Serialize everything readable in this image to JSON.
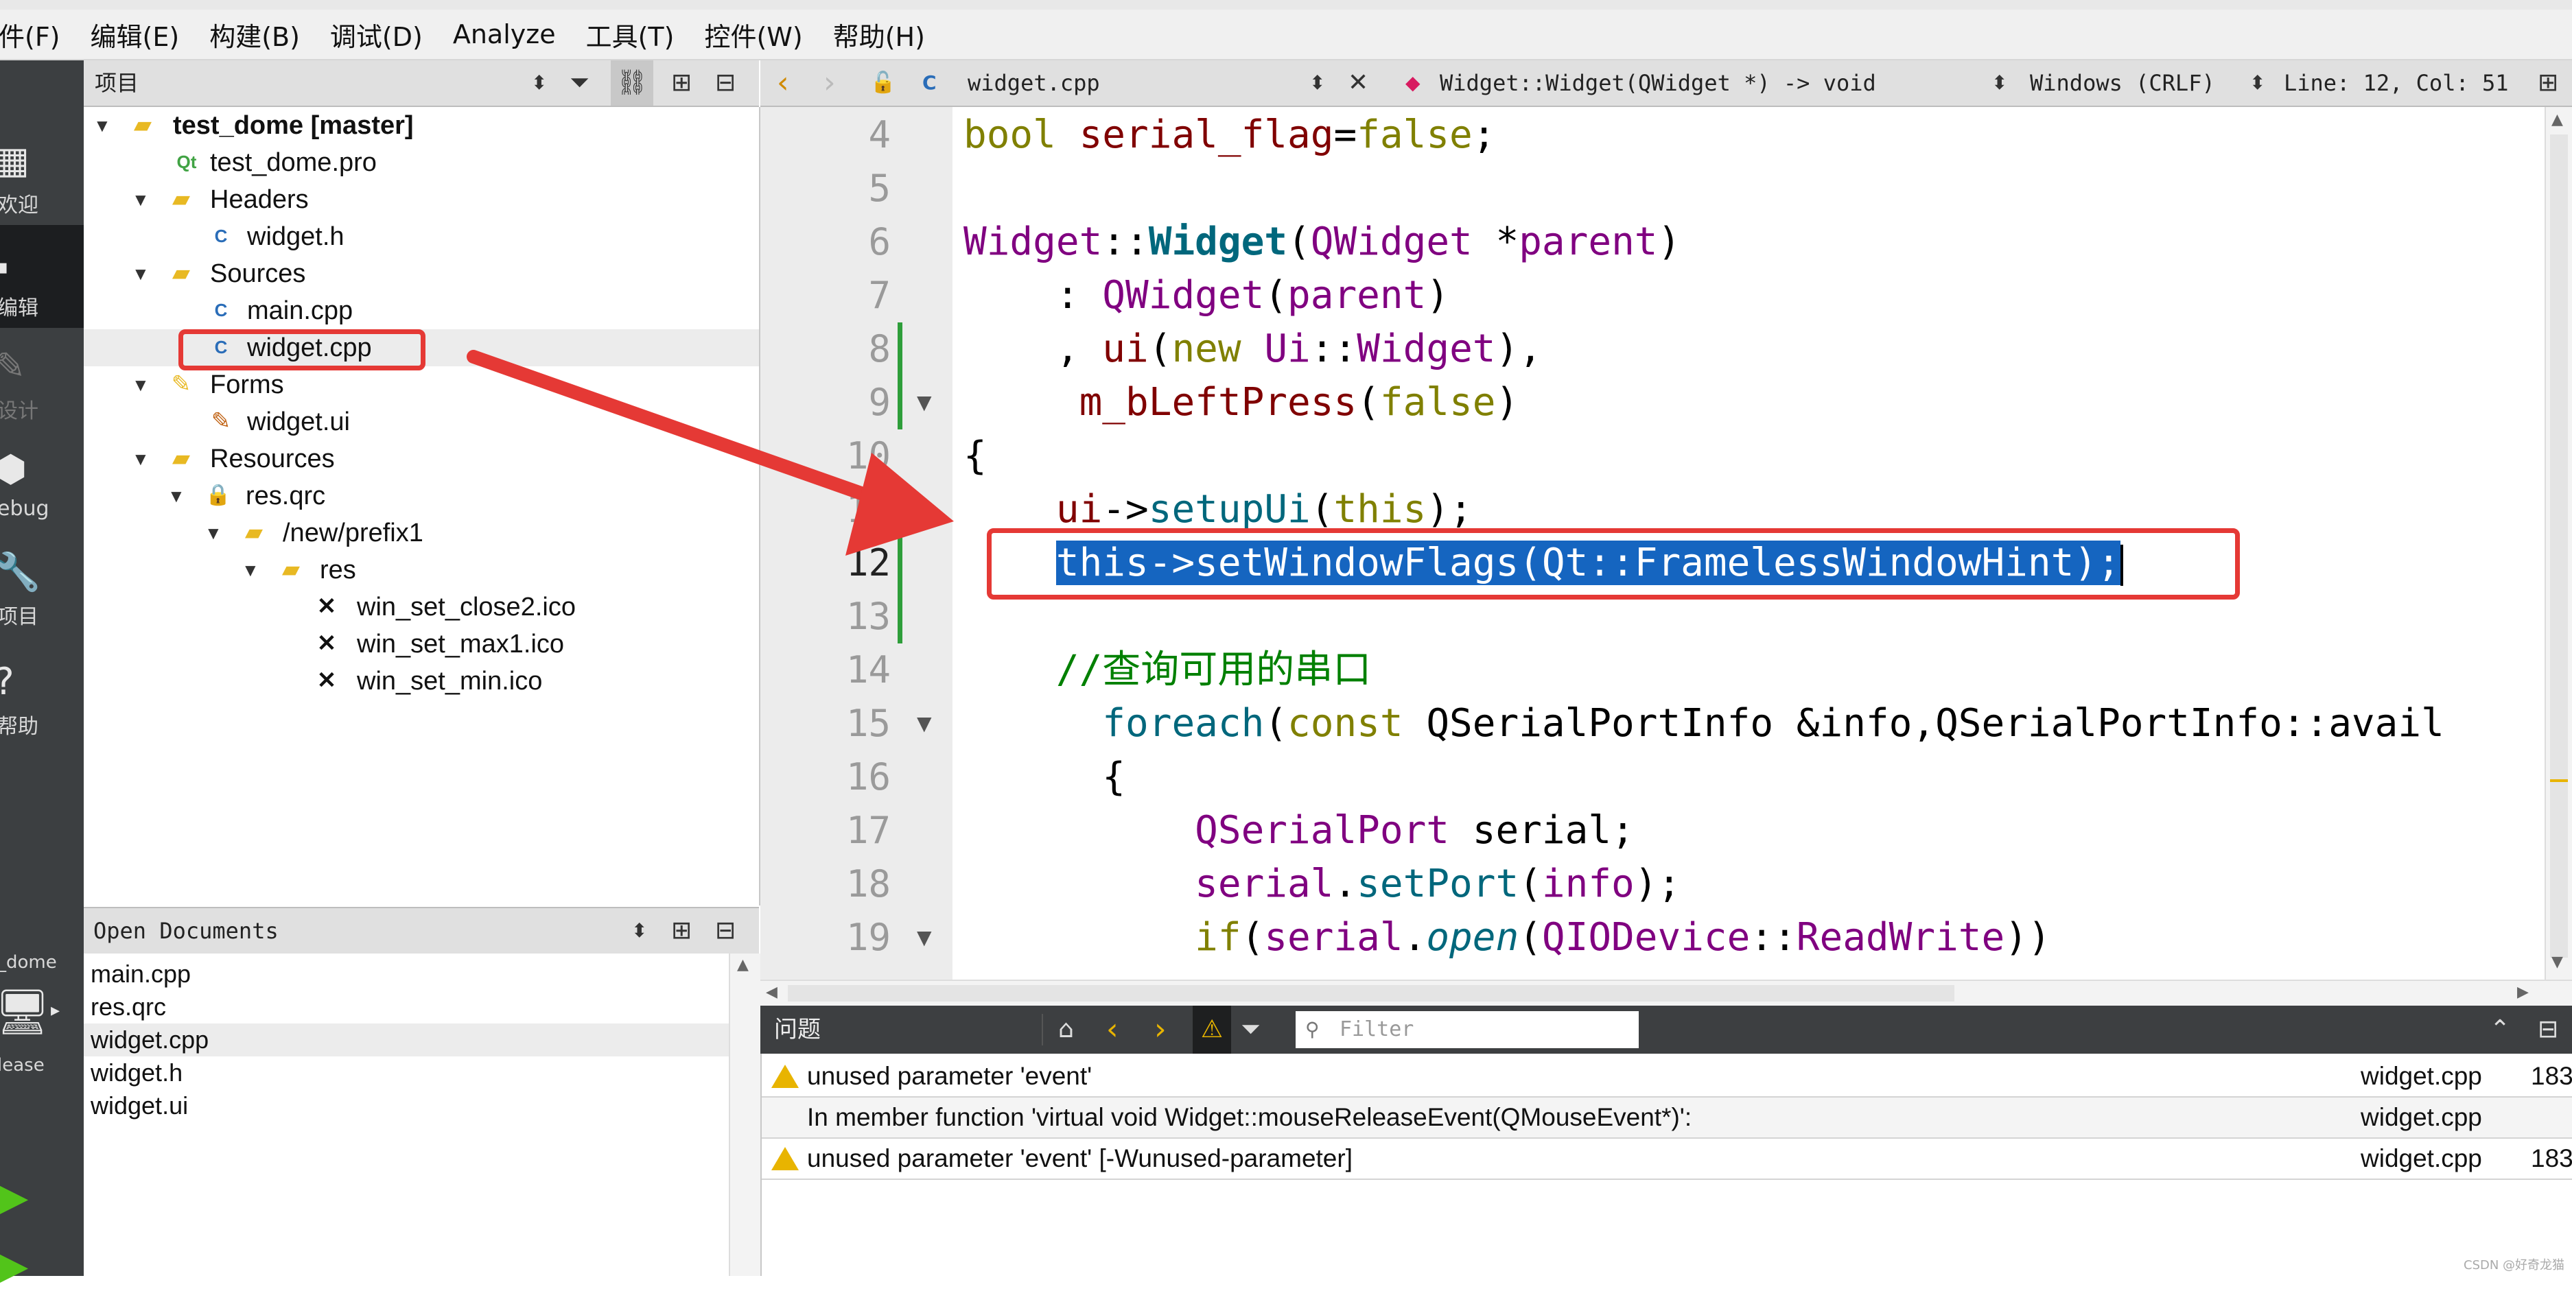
{
  "menu": [
    "件(F)",
    "编辑(E)",
    "构建(B)",
    "调试(D)",
    "Analyze",
    "工具(T)",
    "控件(W)",
    "帮助(H)"
  ],
  "modebar": {
    "welcome": "欢迎",
    "edit": "编辑",
    "design": "设计",
    "debug": "ebug",
    "projects": "项目",
    "help": "帮助",
    "kit": "_dome",
    "build": "lease"
  },
  "project_panel": {
    "title": "项目",
    "tree": [
      {
        "label": "test_dome [master]"
      },
      {
        "label": "test_dome.pro"
      },
      {
        "label": "Headers"
      },
      {
        "label": "widget.h"
      },
      {
        "label": "Sources"
      },
      {
        "label": "main.cpp"
      },
      {
        "label": "widget.cpp"
      },
      {
        "label": "Forms"
      },
      {
        "label": "widget.ui"
      },
      {
        "label": "Resources"
      },
      {
        "label": "res.qrc"
      },
      {
        "label": "/new/prefix1"
      },
      {
        "label": "res"
      },
      {
        "label": "win_set_close2.ico"
      },
      {
        "label": "win_set_max1.ico"
      },
      {
        "label": "win_set_min.ico"
      }
    ]
  },
  "open_documents": {
    "title": "Open Documents",
    "items": [
      "main.cpp",
      "res.qrc",
      "widget.cpp",
      "widget.h",
      "widget.ui"
    ]
  },
  "editor_toolbar": {
    "file": "widget.cpp",
    "symbol": "Widget::Widget(QWidget *) -> void",
    "line_ending": "Windows (CRLF)",
    "position": "Line: 12, Col: 51"
  },
  "line_numbers": [
    "4",
    "5",
    "6",
    "7",
    "8",
    "9",
    "10",
    "11",
    "12",
    "13",
    "14",
    "15",
    "16",
    "17",
    "18",
    "19"
  ],
  "code": {
    "l4a": "bool",
    "l4b": " ",
    "l4c": "serial_flag",
    "l4d": "=",
    "l4e": "false",
    "l4f": ";",
    "l6a": "Widget",
    "l6b": "::",
    "l6c": "Widget",
    "l6d": "(",
    "l6e": "QWidget",
    "l6f": " *",
    "l6g": "parent",
    "l6h": ")",
    "l7a": "    : ",
    "l7b": "QWidget",
    "l7c": "(",
    "l7d": "parent",
    "l7e": ")",
    "l8a": "    , ",
    "l8b": "ui",
    "l8c": "(",
    "l8d": "new",
    "l8e": " ",
    "l8f": "Ui",
    "l8g": "::",
    "l8h": "Widget",
    "l8i": "),",
    "l9a": "     ",
    "l9b": "m_bLeftPress",
    "l9c": "(",
    "l9d": "false",
    "l9e": ")",
    "l10a": "{",
    "l11a": "    ",
    "l11b": "ui",
    "l11c": "->",
    "l11d": "setupUi",
    "l11e": "(",
    "l11f": "this",
    "l11g": ");",
    "l12a": "    ",
    "l12b": "this->setWindowFlags(Qt::FramelessWindowHint);",
    "l14a": "    ",
    "l14b": "//查询可用的串口",
    "l15a": "      ",
    "l15b": "foreach",
    "l15c": "(",
    "l15d": "const",
    "l15e": " ",
    "l15f": "QSerialPortInfo",
    "l15g": " &info,QSerialPortInfo::avail",
    "l16a": "      {",
    "l17a": "          ",
    "l17b": "QSerialPort",
    "l17c": " serial;",
    "l18a": "          ",
    "l18b": "serial",
    "l18c": ".",
    "l18d": "setPort",
    "l18e": "(",
    "l18f": "info",
    "l18g": ");",
    "l19a": "          ",
    "l19b": "if",
    "l19c": "(",
    "l19d": "serial",
    "l19e": ".",
    "l19f": "open",
    "l19g": "(",
    "l19h": "QIODevice",
    "l19i": "::",
    "l19j": "ReadWrite",
    "l19k": "))"
  },
  "issues": {
    "title": "问题",
    "filter_placeholder": "Filter",
    "rows": [
      {
        "text": "unused parameter 'event'",
        "file": "widget.cpp",
        "line": "183"
      },
      {
        "text": "In member function 'virtual void Widget::mouseReleaseEvent(QMouseEvent*)':",
        "file": "widget.cpp",
        "line": ""
      },
      {
        "text": "unused parameter 'event' [-Wunused-parameter]",
        "file": "widget.cpp",
        "line": "183"
      }
    ]
  },
  "watermark": "CSDN @好奇龙猫",
  "colors": {
    "annotation_red": "#e53935",
    "selection_blue": "#1565c0",
    "modebar_bg": "#3c3f41"
  }
}
